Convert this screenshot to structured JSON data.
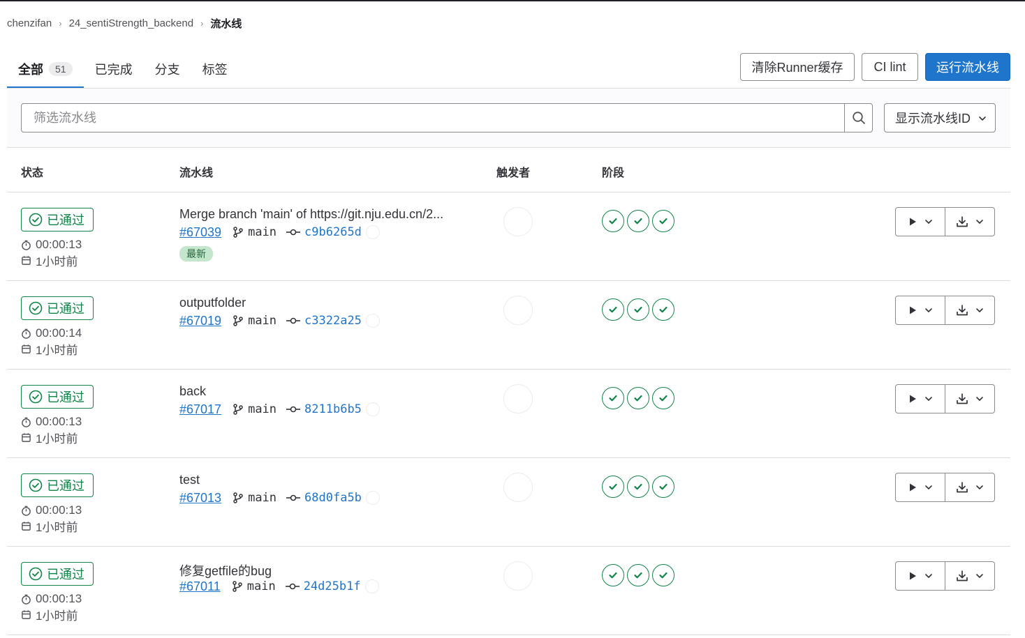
{
  "breadcrumb": {
    "items": [
      "chenzifan",
      "24_sentiStrength_backend"
    ],
    "current": "流水线"
  },
  "tabs": [
    {
      "label": "全部",
      "count": "51",
      "active": true
    },
    {
      "label": "已完成"
    },
    {
      "label": "分支"
    },
    {
      "label": "标签"
    }
  ],
  "toolbar": {
    "clear_cache": "清除Runner缓存",
    "ci_lint": "CI lint",
    "run_pipeline": "运行流水线"
  },
  "filter": {
    "placeholder": "筛选流水线",
    "display_option": "显示流水线ID"
  },
  "table": {
    "headers": {
      "status": "状态",
      "pipeline": "流水线",
      "triggerer": "触发者",
      "stages": "阶段"
    },
    "rows": [
      {
        "status": "已通过",
        "duration": "00:00:13",
        "finished": "1小时前",
        "title": "Merge branch 'main' of https://git.nju.edu.cn/2...",
        "id": "#67039",
        "branch": "main",
        "sha": "c9b6265d",
        "badge": "最新"
      },
      {
        "status": "已通过",
        "duration": "00:00:14",
        "finished": "1小时前",
        "title": "outputfolder",
        "id": "#67019",
        "branch": "main",
        "sha": "c3322a25"
      },
      {
        "status": "已通过",
        "duration": "00:00:13",
        "finished": "1小时前",
        "title": "back",
        "id": "#67017",
        "branch": "main",
        "sha": "8211b6b5"
      },
      {
        "status": "已通过",
        "duration": "00:00:13",
        "finished": "1小时前",
        "title": "test",
        "id": "#67013",
        "branch": "main",
        "sha": "68d0fa5b"
      },
      {
        "status": "已通过",
        "duration": "00:00:13",
        "finished": "1小时前",
        "title": "修复getfile的bug",
        "id": "#67011",
        "branch": "main",
        "sha": "24d25b1f"
      }
    ]
  },
  "icons": {
    "status": "check-circle-icon",
    "duration": "timer-icon",
    "finished": "calendar-icon",
    "branch": "branch-icon",
    "commit": "commit-icon",
    "stage": "status-success-icon",
    "play": "play-icon",
    "download": "download-icon",
    "search": "search-icon",
    "dropdown": "chevron-down-icon"
  },
  "colors": {
    "accent": "#1f75cb",
    "success": "#108548",
    "badge_bg": "#c3e6cd"
  }
}
